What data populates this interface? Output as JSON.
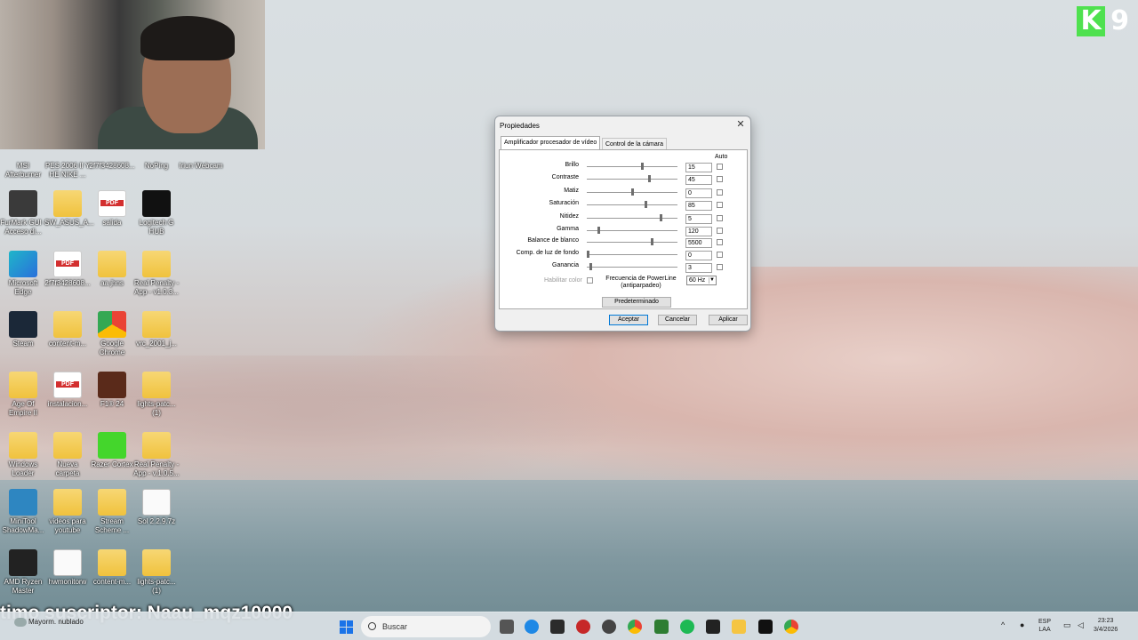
{
  "logo": {
    "letter": "K",
    "number": "9"
  },
  "desktop_icons": [
    {
      "label": "MSI Afterburner",
      "icon": "app-icon"
    },
    {
      "label": "PES 2006 II Y HE NIKE ...",
      "icon": "app-icon"
    },
    {
      "label": "2f7f3428608...",
      "icon": "file-icon"
    },
    {
      "label": "NoPing",
      "icon": "app-icon"
    },
    {
      "label": "Iriun Webcam",
      "icon": "app-icon"
    },
    {
      "label": "FurMark GUI - Acceso di...",
      "icon": "app-icon"
    },
    {
      "label": "SW_ASUS_A...",
      "icon": "folder-icon"
    },
    {
      "label": "salida",
      "icon": "pdf-icon"
    },
    {
      "label": "Logitech G HUB",
      "icon": "logitech-icon"
    },
    {
      "label": "Microsoft Edge",
      "icon": "edge-icon"
    },
    {
      "label": "2f7f3428608...",
      "icon": "pdf-icon"
    },
    {
      "label": "aa jhns",
      "icon": "folder-icon"
    },
    {
      "label": "Real Penalty - App - v1.0.3...",
      "icon": "zip-folder-icon"
    },
    {
      "label": "Steam",
      "icon": "steam-icon"
    },
    {
      "label": "content-m...",
      "icon": "zip-folder-icon"
    },
    {
      "label": "Google Chrome",
      "icon": "chrome-icon"
    },
    {
      "label": "vrc_2001_j...",
      "icon": "folder-icon"
    },
    {
      "label": "Age Of Empire II",
      "icon": "folder-icon"
    },
    {
      "label": "instalacion...",
      "icon": "pdf-icon"
    },
    {
      "label": "F1® 24",
      "icon": "game-icon"
    },
    {
      "label": "lights-patc... (1)",
      "icon": "zip-folder-icon"
    },
    {
      "label": "Windows Loader",
      "icon": "folder-icon"
    },
    {
      "label": "Nueva carpeta",
      "icon": "folder-icon"
    },
    {
      "label": "Razer Cortex",
      "icon": "razer-icon"
    },
    {
      "label": "Real Penalty - App - v.1.0.5...",
      "icon": "zip-folder-icon"
    },
    {
      "label": "MiniTool ShadowMa...",
      "icon": "minitool-icon"
    },
    {
      "label": "videos para youtube",
      "icon": "folder-icon"
    },
    {
      "label": "Stream Scheme ...",
      "icon": "folder-icon"
    },
    {
      "label": "Sol 2.2.9.7z",
      "icon": "file-icon"
    },
    {
      "label": "AMD Ryzen Master",
      "icon": "ryzen-icon"
    },
    {
      "label": "hwmonitorw",
      "icon": "file-icon"
    },
    {
      "label": "content-m...",
      "icon": "zip-folder-icon"
    },
    {
      "label": "lights-patc... (1)",
      "icon": "zip-folder-icon"
    }
  ],
  "overlay": {
    "subscriber_text": "timo suscriptor: Naau_mqz10000"
  },
  "dialog": {
    "title": "Propiedades",
    "tabs": [
      "Amplificador procesador de vídeo",
      "Control de la cámara"
    ],
    "auto_label": "Auto",
    "rows": [
      {
        "name": "Brillo",
        "value": "15",
        "level": 0.62
      },
      {
        "name": "Contraste",
        "value": "45",
        "level": 0.7
      },
      {
        "name": "Matiz",
        "value": "0",
        "level": 0.5
      },
      {
        "name": "Saturación",
        "value": "85",
        "level": 0.66
      },
      {
        "name": "Nitidez",
        "value": "5",
        "level": 0.83
      },
      {
        "name": "Gamma",
        "value": "120",
        "level": 0.12
      },
      {
        "name": "Balance de blanco",
        "value": "5500",
        "level": 0.73
      },
      {
        "name": "Comp. de luz de fondo",
        "value": "0",
        "level": 0.0
      },
      {
        "name": "Ganancia",
        "value": "3",
        "level": 0.03
      }
    ],
    "enable_color_label": "Habilitar color",
    "powerline_label": "Frecuencia de PowerLine (antiparpadeo)",
    "powerline_value": "60 Hz",
    "default_button": "Predeterminado",
    "ok_button": "Aceptar",
    "cancel_button": "Cancelar",
    "apply_button": "Aplicar"
  },
  "taskbar": {
    "weather_text": "Mayorm. nublado",
    "search_placeholder": "Buscar",
    "language": "ESP",
    "language_sub": "LAA",
    "time": "23:23",
    "date": "3/4/2026"
  }
}
